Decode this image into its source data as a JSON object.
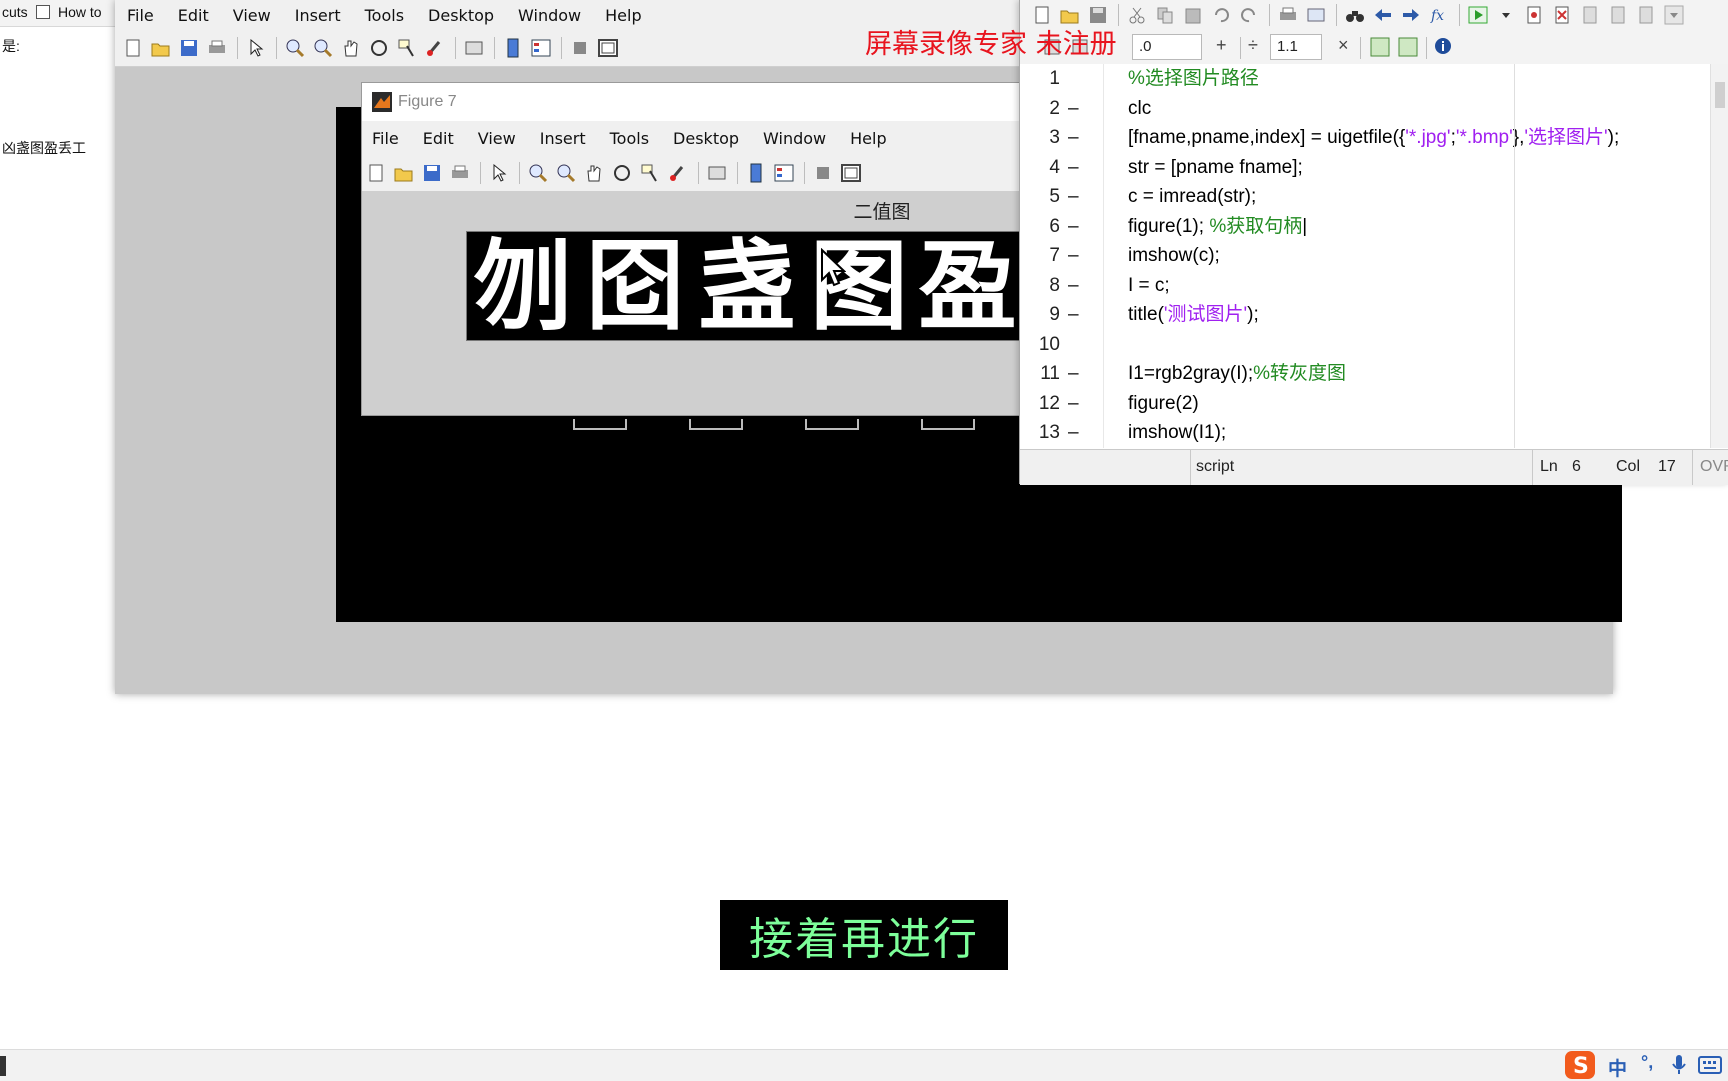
{
  "left_browser": {
    "tab_text_1": "cuts",
    "tab_text_2": "How to",
    "line_1": "是:",
    "line_2": "凶盏图盈丢工"
  },
  "figure_back": {
    "menu": [
      "File",
      "Edit",
      "View",
      "Insert",
      "Tools",
      "Desktop",
      "Window",
      "Help"
    ],
    "axes_title_partial": "二值图"
  },
  "figure7": {
    "window_title": "Figure 7",
    "menu": [
      "File",
      "Edit",
      "View",
      "Insert",
      "Tools",
      "Desktop",
      "Window",
      "Help"
    ],
    "axes_title": "二值图",
    "binary_chars": [
      "刎",
      "囵",
      "盏",
      "图",
      "盈"
    ]
  },
  "editor": {
    "zoom_a_value": ".0",
    "zoom_b_value": "1.1",
    "plus_label": "+",
    "divide_label": "÷",
    "times_label": "×",
    "code_lines": [
      {
        "n": "1",
        "dash": "",
        "segments": [
          {
            "t": "%选择图片路径",
            "c": "cm"
          }
        ]
      },
      {
        "n": "2",
        "dash": "–",
        "segments": [
          {
            "t": "clc",
            "c": ""
          }
        ]
      },
      {
        "n": "3",
        "dash": "–",
        "segments": [
          {
            "t": "[fname,pname,index] = uigetfile({",
            "c": ""
          },
          {
            "t": "'*.jpg'",
            "c": "str"
          },
          {
            "t": ";",
            "c": ""
          },
          {
            "t": "'*.bmp'",
            "c": "str"
          },
          {
            "t": "},",
            "c": ""
          },
          {
            "t": "'选择图片'",
            "c": "str"
          },
          {
            "t": ");",
            "c": ""
          }
        ]
      },
      {
        "n": "4",
        "dash": "–",
        "segments": [
          {
            "t": "str = [pname fname];",
            "c": ""
          }
        ]
      },
      {
        "n": "5",
        "dash": "–",
        "segments": [
          {
            "t": "c = imread(str);",
            "c": ""
          }
        ]
      },
      {
        "n": "6",
        "dash": "–",
        "segments": [
          {
            "t": "figure(1); ",
            "c": ""
          },
          {
            "t": "%获取句柄",
            "c": "cm"
          },
          {
            "t": "|",
            "c": ""
          }
        ]
      },
      {
        "n": "7",
        "dash": "–",
        "segments": [
          {
            "t": "imshow(c);",
            "c": ""
          }
        ]
      },
      {
        "n": "8",
        "dash": "–",
        "segments": [
          {
            "t": "I = c;",
            "c": ""
          }
        ]
      },
      {
        "n": "9",
        "dash": "–",
        "segments": [
          {
            "t": "title(",
            "c": ""
          },
          {
            "t": "'测试图片'",
            "c": "str"
          },
          {
            "t": ");",
            "c": ""
          }
        ]
      },
      {
        "n": "10",
        "dash": "",
        "segments": [
          {
            "t": "",
            "c": ""
          }
        ]
      },
      {
        "n": "11",
        "dash": "–",
        "segments": [
          {
            "t": "I1=rgb2gray(I);",
            "c": ""
          },
          {
            "t": "%转灰度图",
            "c": "cm"
          }
        ]
      },
      {
        "n": "12",
        "dash": "–",
        "segments": [
          {
            "t": "figure(2)",
            "c": ""
          }
        ]
      },
      {
        "n": "13",
        "dash": "–",
        "segments": [
          {
            "t": "imshow(I1);",
            "c": ""
          }
        ]
      }
    ],
    "status": {
      "mode": "script",
      "ln_label": "Ln",
      "ln_value": "6",
      "col_label": "Col",
      "col_value": "17",
      "ovr": "OVR"
    }
  },
  "watermark": "屏幕录像专家  未注册",
  "subtitle": "接着再进行",
  "taskbar": {
    "ime_label": "中",
    "ime_punct": "°,"
  },
  "colors": {
    "comment": "#228b22",
    "string": "#a020f0",
    "watermark": "#e8141e",
    "subtitle_text": "#7dff9a"
  }
}
